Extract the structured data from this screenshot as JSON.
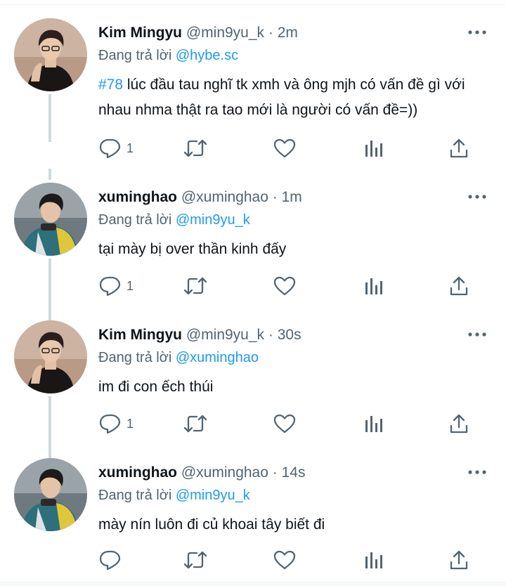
{
  "tweets": [
    {
      "name": "Kim Mingyu",
      "handle": "@min9yu_k",
      "time": "2m",
      "replying_label": "Đang trả lời",
      "replying_to": "@hybe.sc",
      "hashtag": "#78",
      "text": " lúc đầu tau nghĩ tk xmh và ông mjh có vấn đề gì với nhau nhma thật ra tao mới là người có vấn đề=))",
      "reply_count": "1",
      "avatar": "avatar-mingyu"
    },
    {
      "name": "xuminghao",
      "handle": "@xuminghao",
      "time": "1m",
      "replying_label": "Đang trả lời",
      "replying_to": "@min9yu_k",
      "text": "tại mày bị over thần kinh đấy",
      "reply_count": "1",
      "avatar": "avatar-minghao"
    },
    {
      "name": "Kim Mingyu",
      "handle": "@min9yu_k",
      "time": "30s",
      "replying_label": "Đang trả lời",
      "replying_to": "@xuminghao",
      "text": "im đi con ếch thúi",
      "reply_count": "1",
      "avatar": "avatar-mingyu"
    },
    {
      "name": "xuminghao",
      "handle": "@xuminghao",
      "time": "14s",
      "replying_label": "Đang trả lời",
      "replying_to": "@min9yu_k",
      "text": "mày nín luôn đi củ khoai tây biết đi",
      "reply_count": "",
      "avatar": "avatar-minghao"
    }
  ],
  "separator": "·",
  "icons": [
    "reply-icon",
    "retweet-icon",
    "like-icon",
    "analytics-icon",
    "share-icon",
    "more-icon"
  ],
  "colors": {
    "link": "#1d9bf0",
    "muted": "#536471",
    "text": "#0f1419",
    "thread_line": "#cfd9de"
  }
}
